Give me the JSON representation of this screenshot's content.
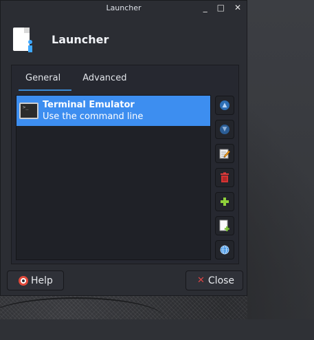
{
  "window": {
    "title": "Launcher",
    "controls": {
      "minimize": "_",
      "maximize": "□",
      "close": "✕"
    }
  },
  "header": {
    "title": "Launcher",
    "icon": "document-info-icon"
  },
  "tabs": [
    {
      "label": "General",
      "active": true
    },
    {
      "label": "Advanced",
      "active": false
    }
  ],
  "items": [
    {
      "name": "Terminal Emulator",
      "description": "Use the command line",
      "icon": "terminal-icon",
      "selected": true
    }
  ],
  "side_buttons": [
    {
      "name": "move-up",
      "icon": "arrow-up-icon",
      "glyph": "▲"
    },
    {
      "name": "move-down",
      "icon": "arrow-down-icon",
      "glyph": "▼"
    },
    {
      "name": "edit-item",
      "icon": "edit-icon"
    },
    {
      "name": "delete-item",
      "icon": "trash-icon"
    },
    {
      "name": "add-item",
      "icon": "plus-icon"
    },
    {
      "name": "add-new-item",
      "icon": "new-document-icon"
    },
    {
      "name": "add-from-web",
      "icon": "globe-icon"
    }
  ],
  "buttons": {
    "help_label": "Help",
    "close_label": "Close"
  },
  "colors": {
    "accent": "#3d8ef0",
    "tab_underline": "#3a8bd6",
    "window_bg": "#2b2d33"
  }
}
